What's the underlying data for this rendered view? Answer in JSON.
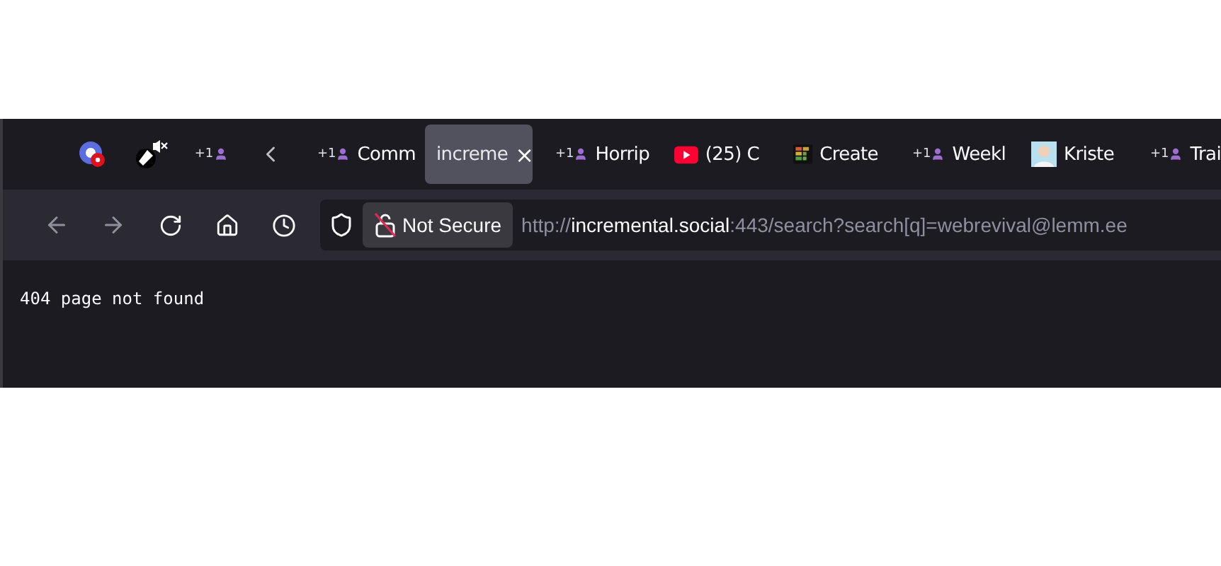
{
  "tabs": [
    {
      "kind": "site-logo",
      "selected": false
    },
    {
      "kind": "speaker",
      "selected": false
    },
    {
      "kind": "plus-one",
      "badge": "+1",
      "selected": false
    },
    {
      "kind": "scroll-left",
      "selected": false
    },
    {
      "kind": "plus-one",
      "badge": "+1",
      "label": "Comm",
      "selected": false
    },
    {
      "kind": "plain",
      "label": "increme",
      "close": "×",
      "selected": true
    },
    {
      "kind": "plus-one",
      "badge": "+1",
      "label": "Horrip",
      "selected": false
    },
    {
      "kind": "video",
      "label": "(25) C",
      "selected": false
    },
    {
      "kind": "grid",
      "label": "Create",
      "selected": false
    },
    {
      "kind": "plus-one",
      "badge": "+1",
      "label": "Weekl",
      "selected": false
    },
    {
      "kind": "avatar",
      "label": "Kriste",
      "selected": false
    },
    {
      "kind": "plus-one",
      "badge": "+1",
      "label": "Trai",
      "selected": false
    }
  ],
  "address_bar": {
    "security": "Not Secure",
    "url_scheme": "http://",
    "url_host": "incremental.social",
    "url_rest": ":443/search?search[q]=webrevival@lemm.ee"
  },
  "content": {
    "message": "404 page not found"
  }
}
